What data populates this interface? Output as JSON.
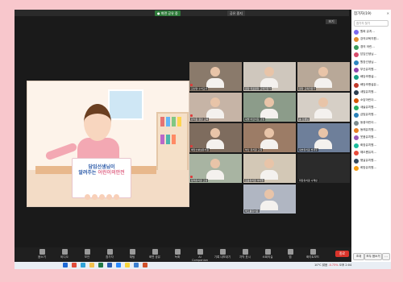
{
  "share_bar": {
    "status_text": "● 화면 공유 중",
    "stop_label": "공유 중지"
  },
  "view_button": {
    "label": "보기"
  },
  "shared_content": {
    "book_line1": "담임선생님이",
    "book_line2_blue": "알려주는 ",
    "book_line2_pink": "어린이의안전"
  },
  "participants_panel": {
    "title": "참가자(19)",
    "search_placeholder": "참가자 찾기",
    "close_icon": "close-icon",
    "footer_invite": "초대",
    "footer_mute_all": "모두 음소거",
    "footer_more": "…",
    "list": [
      {
        "name": "원희 유치...",
        "color": "#7b68ee"
      },
      {
        "name": "강의교육지원...",
        "color": "#e08a2e"
      },
      {
        "name": "경의 어린...",
        "color": "#3a9a5b"
      },
      {
        "name": "담임선생님...",
        "color": "#d64b6b"
      },
      {
        "name": "원장선생님...",
        "color": "#2e86c1"
      },
      {
        "name": "부산유치원...",
        "color": "#8e44ad"
      },
      {
        "name": "배당초병설...",
        "color": "#16a085"
      },
      {
        "name": "배당초병설유...",
        "color": "#c0392b"
      },
      {
        "name": "새빛유치원...",
        "color": "#2c3e50"
      },
      {
        "name": "소담어린이...",
        "color": "#d35400"
      },
      {
        "name": "새솔유치원...",
        "color": "#27ae60"
      },
      {
        "name": "금빛유치원...",
        "color": "#2980b9"
      },
      {
        "name": "동광어린이...",
        "color": "#7f8c8d"
      },
      {
        "name": "동래유치원...",
        "color": "#e67e22"
      },
      {
        "name": "웃음유치원...",
        "color": "#9b59b6"
      },
      {
        "name": "화장유치원...",
        "color": "#1abc9c"
      },
      {
        "name": "해오름유치...",
        "color": "#e74c3c"
      },
      {
        "name": "햇살유치원...",
        "color": "#34495e"
      },
      {
        "name": "희망유치원...",
        "color": "#f39c12"
      }
    ]
  },
  "gallery": {
    "tiles": [
      {
        "name": "김선영 수석교사",
        "bg": "#8a7a6b",
        "mic_muted": true
      },
      {
        "name": "원장 대표원장 교육전문가",
        "bg": "#cfc7bd",
        "mic_muted": false
      },
      {
        "name": "원장 교육전문가",
        "bg": "#b8a898",
        "mic_muted": false
      },
      {
        "name": "유치원 원장 교육",
        "bg": "#c6b4a6",
        "mic_muted": true
      },
      {
        "name": "새빛 어린이집 교실",
        "bg": "#8c9c8a",
        "mic_muted": false
      },
      {
        "name": "송 선생님",
        "bg": "#d6cfc6",
        "mic_muted": false
      },
      {
        "name": "배당초병설유치원",
        "bg": "#7e6c5e",
        "mic_muted": true
      },
      {
        "name": "부산 유치원 교실",
        "bg": "#9c7c66",
        "mic_muted": false
      },
      {
        "name": "새솔유치원 방과후",
        "bg": "#6e7f9a",
        "mic_muted": false
      },
      {
        "name": "동래유치원 교실",
        "bg": "#a8b4a2",
        "mic_muted": true
      },
      {
        "name": "웃음유치원 아이들",
        "bg": "#d3c8b6",
        "mic_muted": false
      },
      {
        "name": "화장유치원 나래반",
        "bg": "#2b2b2b",
        "mic_muted": false
      },
      {
        "name": "해오름유치원",
        "bg": "#b0b6c2",
        "mic_muted": false
      }
    ]
  },
  "toolbar": {
    "buttons": [
      {
        "label": "음소거",
        "icon": "microphone-icon"
      },
      {
        "label": "비디오",
        "icon": "video-camera-icon"
      },
      {
        "label": "보안",
        "icon": "shield-icon"
      },
      {
        "label": "참가자",
        "icon": "participants-icon"
      },
      {
        "label": "채팅",
        "icon": "chat-icon"
      },
      {
        "label": "화면 공유",
        "icon": "share-screen-icon"
      },
      {
        "label": "녹화",
        "icon": "record-icon"
      },
      {
        "label": "AI Companion",
        "icon": "ai-sparkle-icon"
      },
      {
        "label": "기록 내보내기",
        "icon": "export-icon"
      },
      {
        "label": "자막 표시",
        "icon": "caption-icon"
      },
      {
        "label": "소회의실",
        "icon": "breakout-icon"
      },
      {
        "label": "앱",
        "icon": "apps-icon"
      },
      {
        "label": "화이트보드",
        "icon": "whiteboard-icon"
      }
    ],
    "end_label": "종료"
  },
  "taskbar": {
    "apps": [
      {
        "icon": "start-icon",
        "color": "#1e6ad6"
      },
      {
        "icon": "chrome-icon",
        "color": "#e04b3a"
      },
      {
        "icon": "edge-icon",
        "color": "#2fa3d8"
      },
      {
        "icon": "explorer-icon",
        "color": "#f2c14e"
      },
      {
        "icon": "excel-icon",
        "color": "#1f7a45"
      },
      {
        "icon": "word-icon",
        "color": "#2b5fb3"
      },
      {
        "icon": "zoom-icon",
        "color": "#2d8cff"
      },
      {
        "icon": "kakao-icon",
        "color": "#f5d33b"
      },
      {
        "icon": "hwp-icon",
        "color": "#3b7fd1"
      },
      {
        "icon": "ppt-icon",
        "color": "#d0522c"
      }
    ],
    "weather": "10°C 맑음",
    "stock": "-0.73%",
    "time": "오후 2:04"
  }
}
